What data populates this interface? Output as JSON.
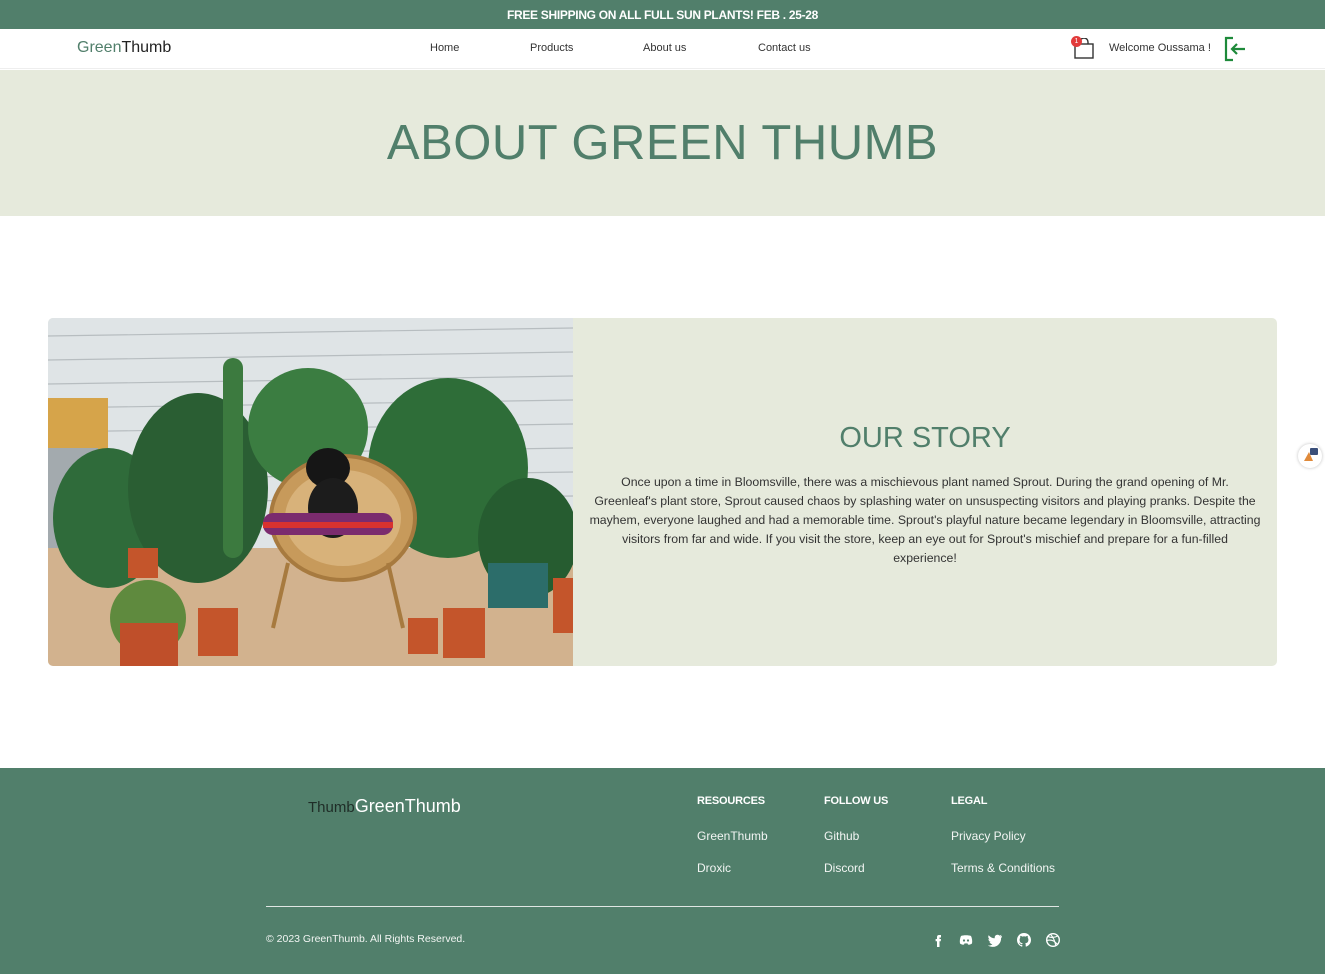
{
  "promo": {
    "text": "FREE SHIPPING ON ALL FULL SUN PLANTS! FEB . 25-28"
  },
  "header": {
    "logo": {
      "part1": "Green",
      "part2": "Thumb"
    },
    "nav": [
      {
        "label": "Home"
      },
      {
        "label": "Products"
      },
      {
        "label": "About us"
      },
      {
        "label": "Contact us"
      }
    ],
    "cart_count": "1",
    "welcome": "Welcome Oussama !"
  },
  "hero": {
    "title": "ABOUT GREEN THUMB"
  },
  "story": {
    "title": "OUR STORY",
    "body": "Once upon a time in Bloomsville, there was a mischievous plant named Sprout. During the grand opening of Mr. Greenleaf's plant store, Sprout caused chaos by splashing water on unsuspecting visitors and playing pranks. Despite the mayhem, everyone laughed and had a memorable time. Sprout's playful nature became legendary in Bloomsville, attracting visitors from far and wide. If you visit the store, keep an eye out for Sprout's mischief and prepare for a fun-filled experience!"
  },
  "footer": {
    "logo": {
      "part1": "Thumb",
      "part2": "GreenThumb"
    },
    "columns": [
      {
        "heading": "RESOURCES",
        "links": [
          "GreenThumb",
          "Droxic"
        ]
      },
      {
        "heading": "FOLLOW US",
        "links": [
          "Github",
          "Discord"
        ]
      },
      {
        "heading": "LEGAL",
        "links": [
          "Privacy Policy",
          "Terms & Conditions"
        ]
      }
    ],
    "copyright": "© 2023 GreenThumb. All Rights Reserved.",
    "socials": [
      "facebook-icon",
      "discord-icon",
      "twitter-icon",
      "github-icon",
      "dribbble-icon"
    ]
  },
  "colors": {
    "primary": "#517f6b",
    "light": "#e6eadc",
    "badge": "#e23b3b"
  }
}
